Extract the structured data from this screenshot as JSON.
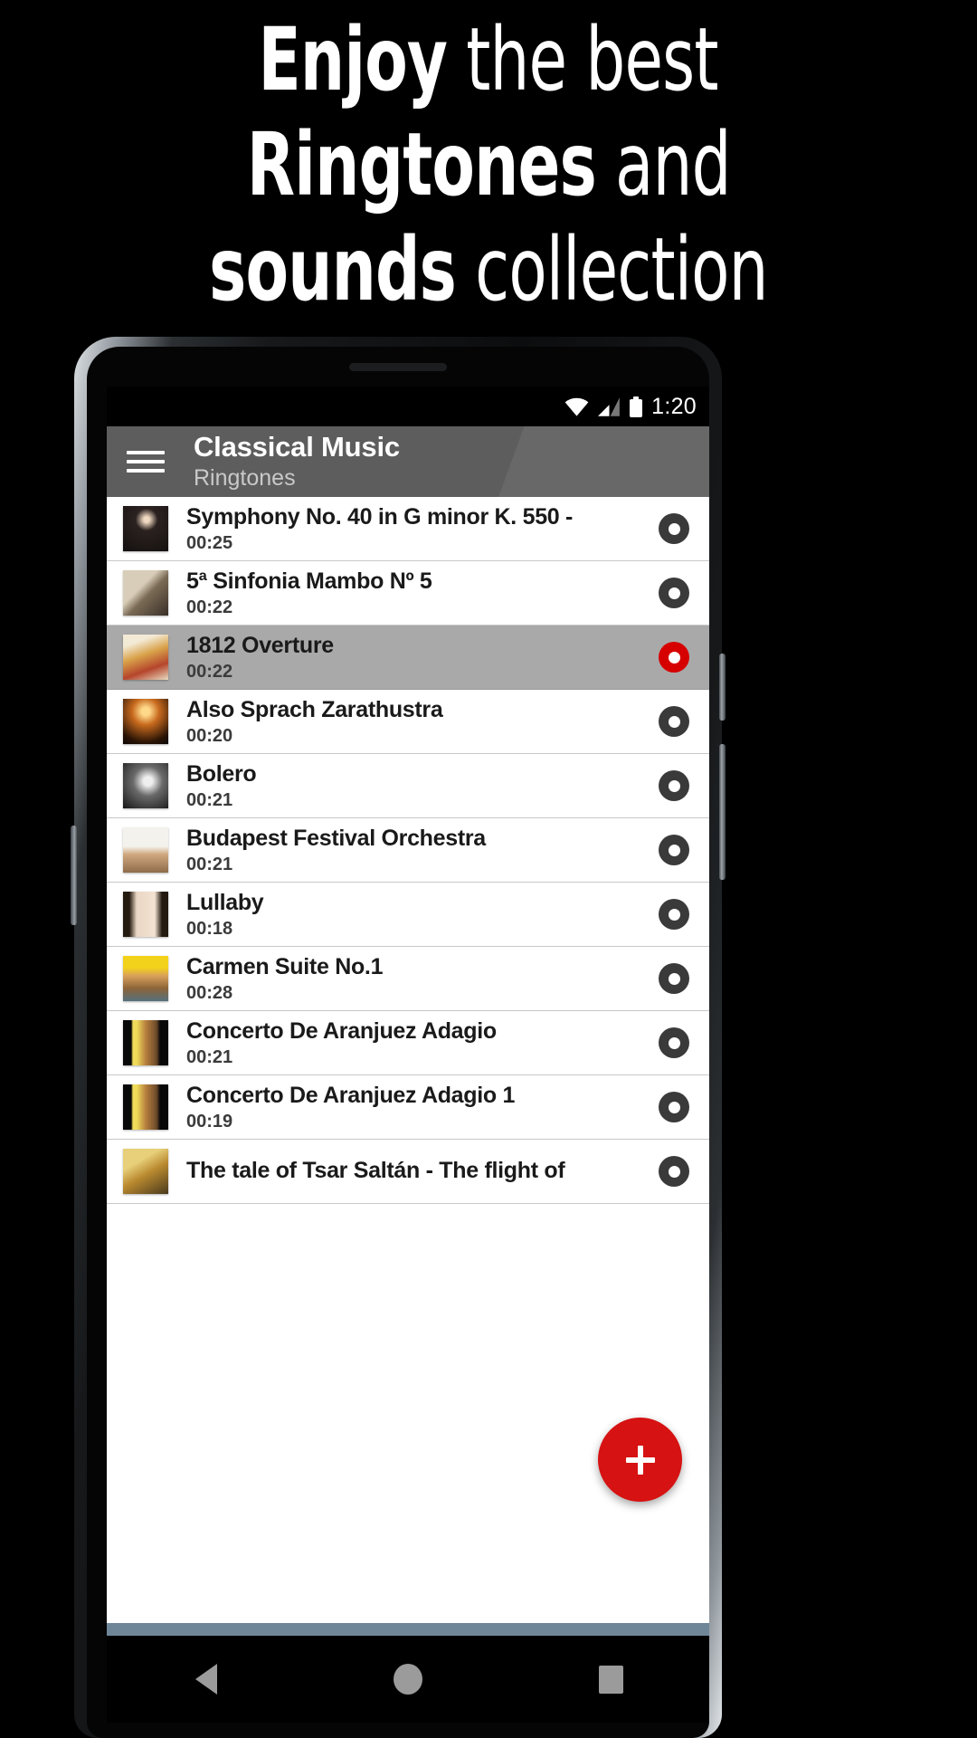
{
  "promo": {
    "lines": [
      {
        "bold": "Enjoy",
        "rest": " the best"
      },
      {
        "bold": "Ringtones",
        "rest": " and"
      },
      {
        "bold": "sounds",
        "rest": " collection"
      }
    ]
  },
  "status_bar": {
    "time": "1:20",
    "icons": [
      "wifi-icon",
      "cellular-signal-icon",
      "battery-icon"
    ]
  },
  "app_bar": {
    "menu_icon": "hamburger-menu-icon",
    "title": "Classical Music",
    "subtitle": "Ringtones"
  },
  "fab": {
    "icon": "plus-icon",
    "label": "+"
  },
  "nav_bar": {
    "back": "back-triangle-icon",
    "home": "home-circle-icon",
    "recents": "recents-square-icon"
  },
  "list": {
    "items": [
      {
        "title": "Symphony No. 40 in G minor K. 550 -",
        "duration": "00:25",
        "selected": false,
        "art": "mozart-portrait"
      },
      {
        "title": "5ª Sinfonia Mambo Nº 5",
        "duration": "00:22",
        "selected": false,
        "art": "beethoven-portrait"
      },
      {
        "title": "1812 Overture",
        "duration": "00:22",
        "selected": true,
        "art": "1812-overture-cover"
      },
      {
        "title": "Also Sprach Zarathustra",
        "duration": "00:20",
        "selected": false,
        "art": "zarathustra-cover"
      },
      {
        "title": "Bolero",
        "duration": "00:21",
        "selected": false,
        "art": "bolero-conductor-bw"
      },
      {
        "title": "Budapest Festival Orchestra",
        "duration": "00:21",
        "selected": false,
        "art": "budapest-cover"
      },
      {
        "title": "Lullaby",
        "duration": "00:18",
        "selected": false,
        "art": "lullaby-baby-cover"
      },
      {
        "title": "Carmen Suite No.1",
        "duration": "00:28",
        "selected": false,
        "art": "carmen-suite-cover"
      },
      {
        "title": "Concerto De Aranjuez Adagio",
        "duration": "00:21",
        "selected": false,
        "art": "aranjuez-cover"
      },
      {
        "title": "Concerto De Aranjuez Adagio 1",
        "duration": "00:19",
        "selected": false,
        "art": "aranjuez-cover"
      },
      {
        "title": "The tale of Tsar Saltán - The flight of",
        "duration": "",
        "selected": false,
        "art": "tsar-saltan-cover"
      }
    ]
  },
  "colors": {
    "accent_red": "#d61212",
    "selected_row": "#a9a9a9",
    "app_bar": "#5d5d5d",
    "radio_off": "#3a3a3a",
    "radio_on": "#d60000"
  }
}
